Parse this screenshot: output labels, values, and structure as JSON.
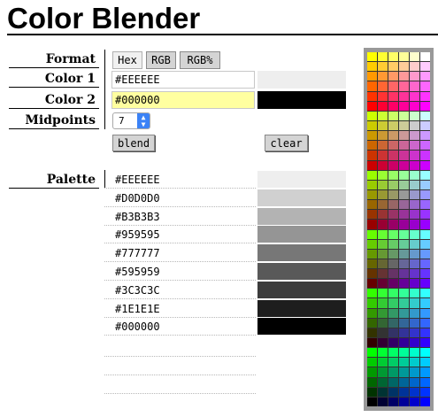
{
  "title": "Color Blender",
  "labels": {
    "format": "Format",
    "color1": "Color 1",
    "color2": "Color 2",
    "midpoints": "Midpoints",
    "palette": "Palette"
  },
  "format_buttons": [
    "Hex",
    "RGB",
    "RGB%"
  ],
  "color1": {
    "value": "#EEEEEE",
    "swatch": "#EEEEEE"
  },
  "color2": {
    "value": "#000000",
    "swatch": "#000000",
    "field_bg": "#FFFFA0"
  },
  "midpoints": {
    "value": "7"
  },
  "buttons": {
    "blend": "blend",
    "clear": "clear"
  },
  "palette": [
    {
      "hex": "#EEEEEE",
      "swatch": "#EEEEEE"
    },
    {
      "hex": "#D0D0D0",
      "swatch": "#D0D0D0"
    },
    {
      "hex": "#B3B3B3",
      "swatch": "#B3B3B3"
    },
    {
      "hex": "#959595",
      "swatch": "#959595"
    },
    {
      "hex": "#777777",
      "swatch": "#777777"
    },
    {
      "hex": "#595959",
      "swatch": "#595959"
    },
    {
      "hex": "#3C3C3C",
      "swatch": "#3C3C3C"
    },
    {
      "hex": "#1E1E1E",
      "swatch": "#1E1E1E"
    },
    {
      "hex": "#000000",
      "swatch": "#000000"
    }
  ],
  "web_safe_palette": {
    "rows": 36,
    "cols": 6
  }
}
